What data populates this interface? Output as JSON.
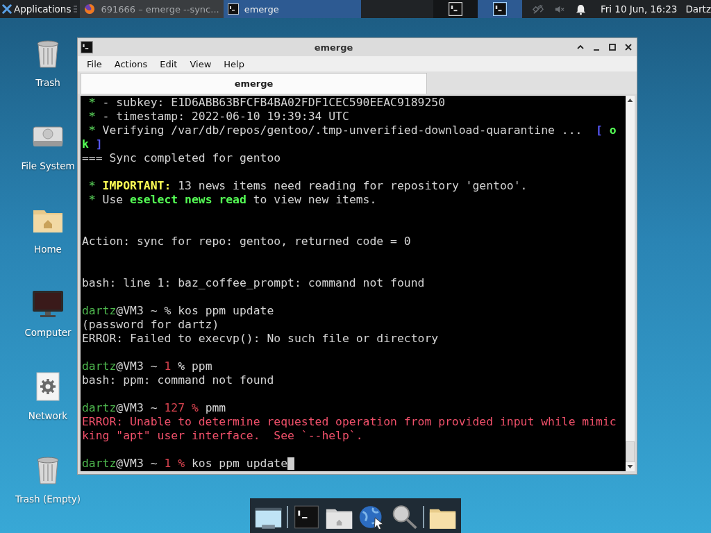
{
  "panel": {
    "applications_label": "Applications",
    "tasks": [
      {
        "title": "691666 – emerge --sync...",
        "kind": "browser",
        "selected": false
      },
      {
        "title": "emerge",
        "kind": "terminal",
        "selected": true
      }
    ],
    "workspaces": [
      {
        "selected": false
      },
      {
        "selected": true
      }
    ],
    "clock": "Fri 10 Jun, 16:23",
    "user": "Dartz"
  },
  "desktop_icons": [
    {
      "label": "Trash",
      "kind": "trash"
    },
    {
      "label": "File System",
      "kind": "drive"
    },
    {
      "label": "Home",
      "kind": "home"
    },
    {
      "label": "Computer",
      "kind": "computer"
    },
    {
      "label": "Network",
      "kind": "network"
    },
    {
      "label": "Trash (Empty)",
      "kind": "trash"
    }
  ],
  "window": {
    "title": "emerge",
    "menu": [
      "File",
      "Actions",
      "Edit",
      "View",
      "Help"
    ],
    "tabs": [
      {
        "label": "emerge",
        "selected": true
      }
    ],
    "terminal": {
      "lines": [
        {
          "kind": "text",
          "segments": [
            {
              "kind": "star",
              "text": " * "
            },
            {
              "kind": "plain",
              "text": "- subkey: E1D6ABB63BFCFB4BA02FDF1CEC590EEAC9189250"
            }
          ]
        },
        {
          "kind": "text",
          "segments": [
            {
              "kind": "star",
              "text": " * "
            },
            {
              "kind": "plain",
              "text": "- timestamp: 2022-06-10 19:39:34 UTC"
            }
          ]
        },
        {
          "kind": "text",
          "segments": [
            {
              "kind": "star",
              "text": " * "
            },
            {
              "kind": "plain",
              "text": "Verifying /var/db/repos/gentoo/.tmp-unverified-download-quarantine ...  "
            },
            {
              "kind": "bracket",
              "text": "[ "
            },
            {
              "kind": "ok",
              "text": "o"
            }
          ]
        },
        {
          "kind": "text",
          "segments": [
            {
              "kind": "ok",
              "text": "k"
            },
            {
              "kind": "bracket",
              "text": " ]"
            }
          ]
        },
        {
          "kind": "text",
          "segments": [
            {
              "kind": "plain",
              "text": "=== Sync completed for gentoo"
            }
          ]
        },
        {
          "kind": "blank"
        },
        {
          "kind": "text",
          "segments": [
            {
              "kind": "star",
              "text": " * "
            },
            {
              "kind": "important",
              "text": "IMPORTANT:"
            },
            {
              "kind": "plain",
              "text": " 13 news items need reading for repository 'gentoo'."
            }
          ]
        },
        {
          "kind": "text",
          "segments": [
            {
              "kind": "star",
              "text": " * "
            },
            {
              "kind": "plain",
              "text": "Use "
            },
            {
              "kind": "ok",
              "text": "eselect news read"
            },
            {
              "kind": "plain",
              "text": " to view new items."
            }
          ]
        },
        {
          "kind": "blank"
        },
        {
          "kind": "blank"
        },
        {
          "kind": "text",
          "segments": [
            {
              "kind": "plain",
              "text": "Action: sync for repo: gentoo, returned code = 0"
            }
          ]
        },
        {
          "kind": "blank"
        },
        {
          "kind": "blank"
        },
        {
          "kind": "text",
          "segments": [
            {
              "kind": "plain",
              "text": "bash: line 1: baz_coffee_prompt: command not found"
            }
          ]
        },
        {
          "kind": "blank"
        },
        {
          "kind": "text",
          "segments": [
            {
              "kind": "user",
              "text": "dartz"
            },
            {
              "kind": "plain",
              "text": "@VM3 ~ % kos ppm update"
            }
          ]
        },
        {
          "kind": "text",
          "segments": [
            {
              "kind": "plain",
              "text": "(password for dartz)"
            }
          ]
        },
        {
          "kind": "text",
          "segments": [
            {
              "kind": "plain",
              "text": "ERROR: Failed to execvp(): No such file or directory"
            }
          ]
        },
        {
          "kind": "blank"
        },
        {
          "kind": "text",
          "segments": [
            {
              "kind": "user",
              "text": "dartz"
            },
            {
              "kind": "plain",
              "text": "@VM3 ~ "
            },
            {
              "kind": "code",
              "text": "1"
            },
            {
              "kind": "plain",
              "text": " % ppm"
            }
          ]
        },
        {
          "kind": "text",
          "segments": [
            {
              "kind": "plain",
              "text": "bash: ppm: command not found"
            }
          ]
        },
        {
          "kind": "blank"
        },
        {
          "kind": "text",
          "segments": [
            {
              "kind": "user",
              "text": "dartz"
            },
            {
              "kind": "plain",
              "text": "@VM3 ~ "
            },
            {
              "kind": "code",
              "text": "127 %"
            },
            {
              "kind": "plain",
              "text": " pmm"
            }
          ]
        },
        {
          "kind": "text",
          "segments": [
            {
              "kind": "error",
              "text": "ERROR: Unable to determine requested operation from provided input while mimic"
            }
          ]
        },
        {
          "kind": "text",
          "segments": [
            {
              "kind": "error",
              "text": "king \"apt\" user interface.  See `--help`."
            }
          ]
        },
        {
          "kind": "blank"
        },
        {
          "kind": "text",
          "cursor": true,
          "segments": [
            {
              "kind": "user",
              "text": "dartz"
            },
            {
              "kind": "plain",
              "text": "@VM3 ~ "
            },
            {
              "kind": "code",
              "text": "1 %"
            },
            {
              "kind": "plain",
              "text": " kos ppm update"
            }
          ]
        }
      ]
    }
  }
}
